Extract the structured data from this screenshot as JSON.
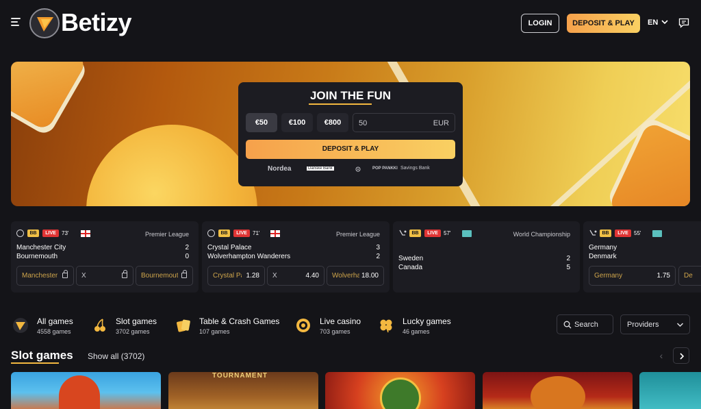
{
  "header": {
    "brand": "Betizy",
    "login_label": "LOGIN",
    "deposit_label": "DEPOSIT & PLAY",
    "language": "EN"
  },
  "hero": {
    "title": "JOIN THE FUN",
    "amounts": [
      "€50",
      "€100",
      "€800"
    ],
    "selected_amount": "€50",
    "input_value": "50",
    "currency": "EUR",
    "deposit_label": "DEPOSIT & PLAY",
    "banks": [
      "Nordea",
      "Danske Bank",
      "POP PANKKI",
      "Savings Bank"
    ]
  },
  "matches": [
    {
      "minute": "73'",
      "league": "Premier League",
      "team1": "Manchester City",
      "score1": "2",
      "team2": "Bournemouth",
      "score2": "0",
      "odds": [
        {
          "label": "Manchester City",
          "value": ""
        },
        {
          "label": "X",
          "value": ""
        },
        {
          "label": "Bournemouth",
          "value": ""
        }
      ]
    },
    {
      "minute": "71'",
      "league": "Premier League",
      "team1": "Crystal Palace",
      "score1": "3",
      "team2": "Wolverhampton Wanderers",
      "score2": "2",
      "odds": [
        {
          "label": "Crystal Palace",
          "value": "1.28"
        },
        {
          "label": "X",
          "value": "4.40"
        },
        {
          "label": "Wolverhampton",
          "value": "18.00"
        }
      ]
    },
    {
      "minute": "57'",
      "league": "World Championship",
      "team1": "Sweden",
      "score1": "2",
      "team2": "Canada",
      "score2": "5",
      "odds": []
    },
    {
      "minute": "55'",
      "league": "",
      "team1": "Germany",
      "score1": "",
      "team2": "Denmark",
      "score2": "",
      "odds": [
        {
          "label": "Germany",
          "value": "1.75"
        },
        {
          "label": "De",
          "value": ""
        }
      ]
    }
  ],
  "badges": {
    "bb": "BB",
    "live": "LIVE"
  },
  "categories": [
    {
      "title": "All games",
      "count": "4558 games",
      "icon": "play-icon"
    },
    {
      "title": "Slot games",
      "count": "3702 games",
      "icon": "cherry-icon"
    },
    {
      "title": "Table & Crash Games",
      "count": "107 games",
      "icon": "cards-icon"
    },
    {
      "title": "Live casino",
      "count": "703 games",
      "icon": "chip-icon"
    },
    {
      "title": "Lucky games",
      "count": "46 games",
      "icon": "clover-icon"
    }
  ],
  "search_label": "Search",
  "providers_label": "Providers",
  "slots": {
    "title": "Slot games",
    "show_all": "Show all (3702)",
    "tournament_text": "TOURNAMENT"
  },
  "colors": {
    "accent": "#f6a14b",
    "accent_2": "#f9d062",
    "live": "#e03434",
    "background": "#141418"
  }
}
